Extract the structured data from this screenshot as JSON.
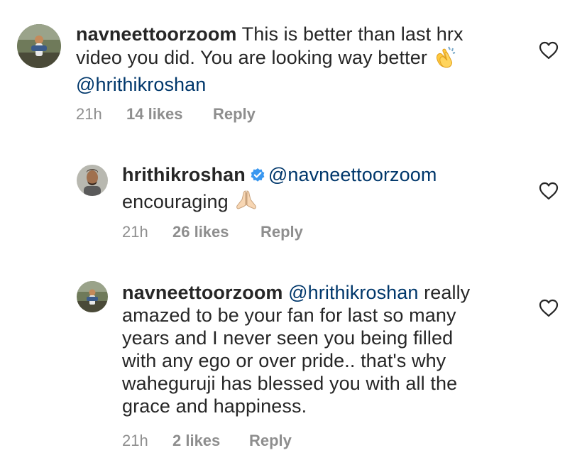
{
  "comments": [
    {
      "username": "navneettoorzoom",
      "text_parts": [
        "This is better than last hrx",
        "video you did. You are looking way better"
      ],
      "mention": "@hrithikroshan",
      "emoji": "clapping-hands",
      "time": "21h",
      "likes": "14 likes",
      "reply": "Reply"
    },
    {
      "username": "hrithikroshan",
      "verified": true,
      "mention": "@navneettoorzoom",
      "text": "encouraging",
      "emoji": "folded-hands",
      "time": "21h",
      "likes": "26 likes",
      "reply": "Reply"
    },
    {
      "username": "navneettoorzoom",
      "mention": "@hrithikroshan",
      "lines": [
        "really",
        "amazed to be your fan for last so many",
        "years and I never seen you being filled",
        "with any ego or over pride.. that's why",
        "waheguruji has blessed you with all the",
        "grace and happiness."
      ],
      "time": "21h",
      "likes": "2 likes",
      "reply": "Reply"
    }
  ],
  "colors": {
    "text": "#262626",
    "mention": "#00376b",
    "meta": "#8e8e8e",
    "verified": "#3897f0"
  }
}
